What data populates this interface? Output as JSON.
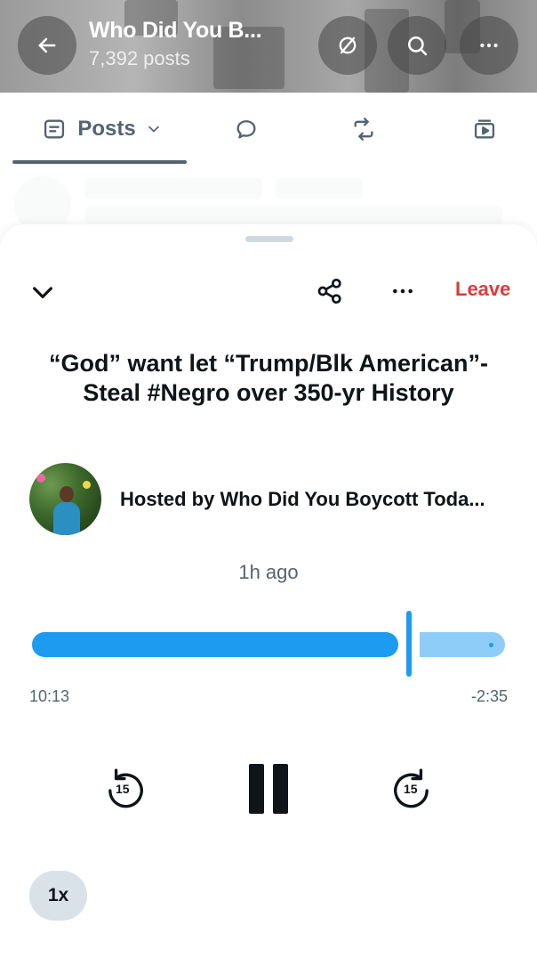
{
  "profile_header": {
    "title": "Who Did You B...",
    "subtitle": "7,392 posts",
    "back_icon": "arrow-left-icon",
    "actions": [
      "spaces-off-icon",
      "search-icon",
      "more-icon"
    ]
  },
  "tabs": {
    "posts_label": "Posts",
    "items": [
      "posts-tab",
      "replies-tab",
      "reposts-tab",
      "media-tab"
    ]
  },
  "sheet": {
    "leave_label": "Leave",
    "title": "“God” want let “Trump/Blk American”- Steal #Negro over 350-yr History",
    "host_text": "Hosted by Who Did You Boycott Toda...",
    "time_ago": "1h ago",
    "player": {
      "elapsed": "10:13",
      "remaining": "-2:35",
      "progress_fraction": 0.797,
      "skip_back_seconds": "15",
      "skip_forward_seconds": "15",
      "speed": "1x"
    }
  },
  "colors": {
    "accent": "#1d9bf0",
    "accent_light": "#8ecdf8",
    "leave": "#d83c3c",
    "secondary_text": "#536471"
  }
}
